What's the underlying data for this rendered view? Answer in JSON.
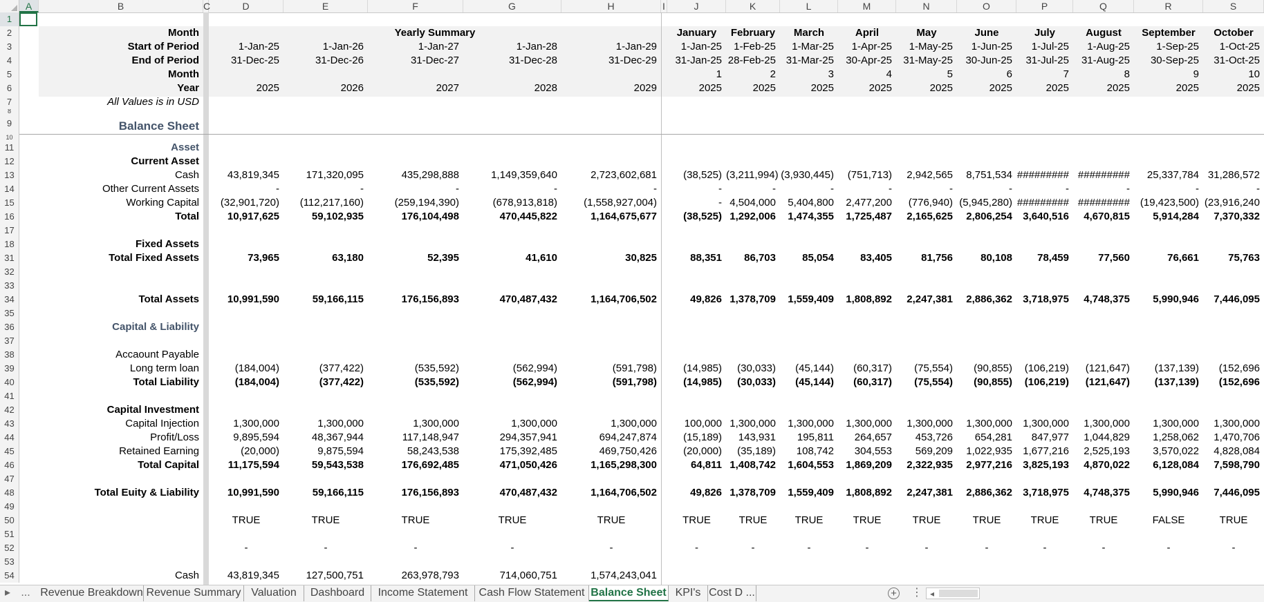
{
  "columns": [
    "A",
    "B",
    "C",
    "D",
    "E",
    "F",
    "G",
    "H",
    "I",
    "J",
    "K",
    "L",
    "M",
    "N",
    "O",
    "P",
    "Q",
    "R",
    "S"
  ],
  "rows": [
    "1",
    "2",
    "3",
    "4",
    "5",
    "6",
    "7",
    "8",
    "9",
    "10",
    "11",
    "12",
    "13",
    "14",
    "15",
    "16",
    "17",
    "18",
    "31",
    "32",
    "33",
    "34",
    "35",
    "36",
    "37",
    "38",
    "39",
    "40",
    "41",
    "42",
    "43",
    "44",
    "45",
    "46",
    "47",
    "48",
    "49",
    "50",
    "51",
    "52",
    "53",
    "54"
  ],
  "header_labels": {
    "month": "Month",
    "start": "Start of Period",
    "end": "End of Period",
    "month_num": "Month",
    "year": "Year",
    "note": "All Values is in USD",
    "yearly_summary": "Yearly Summary"
  },
  "yearly": {
    "start": [
      "1-Jan-25",
      "1-Jan-26",
      "1-Jan-27",
      "1-Jan-28",
      "1-Jan-29"
    ],
    "end": [
      "31-Dec-25",
      "31-Dec-26",
      "31-Dec-27",
      "31-Dec-28",
      "31-Dec-29"
    ],
    "year": [
      "2025",
      "2026",
      "2027",
      "2028",
      "2029"
    ]
  },
  "monthly": {
    "names": [
      "January",
      "February",
      "March",
      "April",
      "May",
      "June",
      "July",
      "August",
      "September",
      "October"
    ],
    "start": [
      "1-Jan-25",
      "1-Feb-25",
      "1-Mar-25",
      "1-Apr-25",
      "1-May-25",
      "1-Jun-25",
      "1-Jul-25",
      "1-Aug-25",
      "1-Sep-25",
      "1-Oct-25"
    ],
    "end": [
      "31-Jan-25",
      "28-Feb-25",
      "31-Mar-25",
      "30-Apr-25",
      "31-May-25",
      "30-Jun-25",
      "31-Jul-25",
      "31-Aug-25",
      "30-Sep-25",
      "31-Oct-25"
    ],
    "num": [
      "1",
      "2",
      "3",
      "4",
      "5",
      "6",
      "7",
      "8",
      "9",
      "10"
    ],
    "year": [
      "2025",
      "2025",
      "2025",
      "2025",
      "2025",
      "2025",
      "2025",
      "2025",
      "2025",
      "2025"
    ]
  },
  "sheet_title": "Balance Sheet",
  "lines": [
    {
      "row": "11",
      "label": "Asset",
      "style": "section"
    },
    {
      "row": "12",
      "label": "Current Asset",
      "style": "bold"
    },
    {
      "row": "13",
      "label": "Cash",
      "style": "normal",
      "yearly": [
        "43,819,345",
        "171,320,095",
        "435,298,888",
        "1,149,359,640",
        "2,723,602,681"
      ],
      "monthly": [
        "(38,525)",
        "(3,211,994)",
        "(3,930,445)",
        "(751,713)",
        "2,942,565",
        "8,751,534",
        "#########",
        "#########",
        "25,337,784",
        "31,286,572"
      ]
    },
    {
      "row": "14",
      "label": "Other Current Assets",
      "style": "normal",
      "yearly": [
        "-",
        "-",
        "-",
        "-",
        "-"
      ],
      "monthly": [
        "-",
        "-",
        "-",
        "-",
        "-",
        "-",
        "-",
        "-",
        "-",
        "-"
      ]
    },
    {
      "row": "15",
      "label": "Working Capital",
      "style": "normal",
      "yearly": [
        "(32,901,720)",
        "(112,217,160)",
        "(259,194,390)",
        "(678,913,818)",
        "(1,558,927,004)"
      ],
      "monthly": [
        "-",
        "4,504,000",
        "5,404,800",
        "2,477,200",
        "(776,940)",
        "(5,945,280)",
        "#########",
        "#########",
        "(19,423,500)",
        "(23,916,240"
      ]
    },
    {
      "row": "16",
      "label": "Total",
      "style": "bold",
      "yearly": [
        "10,917,625",
        "59,102,935",
        "176,104,498",
        "470,445,822",
        "1,164,675,677"
      ],
      "monthly": [
        "(38,525)",
        "1,292,006",
        "1,474,355",
        "1,725,487",
        "2,165,625",
        "2,806,254",
        "3,640,516",
        "4,670,815",
        "5,914,284",
        "7,370,332"
      ]
    },
    {
      "row": "18",
      "label": "Fixed Assets",
      "style": "bold"
    },
    {
      "row": "31",
      "label": "Total Fixed Assets",
      "style": "bold",
      "yearly": [
        "73,965",
        "63,180",
        "52,395",
        "41,610",
        "30,825"
      ],
      "monthly": [
        "88,351",
        "86,703",
        "85,054",
        "83,405",
        "81,756",
        "80,108",
        "78,459",
        "77,560",
        "76,661",
        "75,763"
      ]
    },
    {
      "row": "34",
      "label": "Total Assets",
      "style": "bold",
      "yearly": [
        "10,991,590",
        "59,166,115",
        "176,156,893",
        "470,487,432",
        "1,164,706,502"
      ],
      "monthly": [
        "49,826",
        "1,378,709",
        "1,559,409",
        "1,808,892",
        "2,247,381",
        "2,886,362",
        "3,718,975",
        "4,748,375",
        "5,990,946",
        "7,446,095"
      ]
    },
    {
      "row": "36",
      "label": "Capital & Liability",
      "style": "section"
    },
    {
      "row": "38",
      "label": "Accaount Payable",
      "style": "normal"
    },
    {
      "row": "39",
      "label": "Long term loan",
      "style": "normal",
      "yearly": [
        "(184,004)",
        "(377,422)",
        "(535,592)",
        "(562,994)",
        "(591,798)"
      ],
      "monthly": [
        "(14,985)",
        "(30,033)",
        "(45,144)",
        "(60,317)",
        "(75,554)",
        "(90,855)",
        "(106,219)",
        "(121,647)",
        "(137,139)",
        "(152,696"
      ]
    },
    {
      "row": "40",
      "label": "Total Liability",
      "style": "bold",
      "yearly": [
        "(184,004)",
        "(377,422)",
        "(535,592)",
        "(562,994)",
        "(591,798)"
      ],
      "monthly": [
        "(14,985)",
        "(30,033)",
        "(45,144)",
        "(60,317)",
        "(75,554)",
        "(90,855)",
        "(106,219)",
        "(121,647)",
        "(137,139)",
        "(152,696"
      ]
    },
    {
      "row": "42",
      "label": "Capital Investment",
      "style": "bold"
    },
    {
      "row": "43",
      "label": "Capital Injection",
      "style": "normal",
      "yearly": [
        "1,300,000",
        "1,300,000",
        "1,300,000",
        "1,300,000",
        "1,300,000"
      ],
      "monthly": [
        "100,000",
        "1,300,000",
        "1,300,000",
        "1,300,000",
        "1,300,000",
        "1,300,000",
        "1,300,000",
        "1,300,000",
        "1,300,000",
        "1,300,000"
      ]
    },
    {
      "row": "44",
      "label": "Profit/Loss",
      "style": "normal",
      "yearly": [
        "9,895,594",
        "48,367,944",
        "117,148,947",
        "294,357,941",
        "694,247,874"
      ],
      "monthly": [
        "(15,189)",
        "143,931",
        "195,811",
        "264,657",
        "453,726",
        "654,281",
        "847,977",
        "1,044,829",
        "1,258,062",
        "1,470,706"
      ]
    },
    {
      "row": "45",
      "label": "Retained Earning",
      "style": "normal",
      "yearly": [
        "(20,000)",
        "9,875,594",
        "58,243,538",
        "175,392,485",
        "469,750,426"
      ],
      "monthly": [
        "(20,000)",
        "(35,189)",
        "108,742",
        "304,553",
        "569,209",
        "1,022,935",
        "1,677,216",
        "2,525,193",
        "3,570,022",
        "4,828,084"
      ]
    },
    {
      "row": "46",
      "label": "Total Capital",
      "style": "bold",
      "yearly": [
        "11,175,594",
        "59,543,538",
        "176,692,485",
        "471,050,426",
        "1,165,298,300"
      ],
      "monthly": [
        "64,811",
        "1,408,742",
        "1,604,553",
        "1,869,209",
        "2,322,935",
        "2,977,216",
        "3,825,193",
        "4,870,022",
        "6,128,084",
        "7,598,790"
      ]
    },
    {
      "row": "48",
      "label": "Total Euity & Liability",
      "style": "bold",
      "yearly": [
        "10,991,590",
        "59,166,115",
        "176,156,893",
        "470,487,432",
        "1,164,706,502"
      ],
      "monthly": [
        "49,826",
        "1,378,709",
        "1,559,409",
        "1,808,892",
        "2,247,381",
        "2,886,362",
        "3,718,975",
        "4,748,375",
        "5,990,946",
        "7,446,095"
      ]
    },
    {
      "row": "50",
      "label": "",
      "style": "center",
      "yearly": [
        "TRUE",
        "TRUE",
        "TRUE",
        "TRUE",
        "TRUE"
      ],
      "monthly": [
        "TRUE",
        "TRUE",
        "TRUE",
        "TRUE",
        "TRUE",
        "TRUE",
        "TRUE",
        "TRUE",
        "FALSE",
        "TRUE"
      ]
    },
    {
      "row": "52",
      "label": "",
      "style": "center",
      "yearly": [
        "-",
        "-",
        "-",
        "-",
        "-"
      ],
      "monthly": [
        "-",
        "-",
        "-",
        "-",
        "-",
        "-",
        "-",
        "-",
        "-",
        "-"
      ]
    },
    {
      "row": "54",
      "label": "Cash",
      "style": "normal",
      "yearly": [
        "43,819,345",
        "127,500,751",
        "263,978,793",
        "714,060,751",
        "1,574,243,041"
      ]
    }
  ],
  "tabs": [
    {
      "label": "Revenue Breakdown",
      "active": false
    },
    {
      "label": "Revenue Summary",
      "active": false
    },
    {
      "label": "Valuation",
      "active": false
    },
    {
      "label": "Dashboard",
      "active": false
    },
    {
      "label": "Income Statement",
      "active": false
    },
    {
      "label": "Cash Flow Statement",
      "active": false
    },
    {
      "label": "Balance Sheet",
      "active": true
    },
    {
      "label": "KPI's",
      "active": false
    },
    {
      "label": "Cost D ...",
      "active": false
    }
  ],
  "tab_nav": {
    "next": "▸",
    "more": "...",
    "add": "+",
    "options": "⋮",
    "scroll_left": "◂"
  },
  "colors": {
    "accent": "#217346",
    "section": "#44546a",
    "header_fill": "#f2f2f2"
  }
}
